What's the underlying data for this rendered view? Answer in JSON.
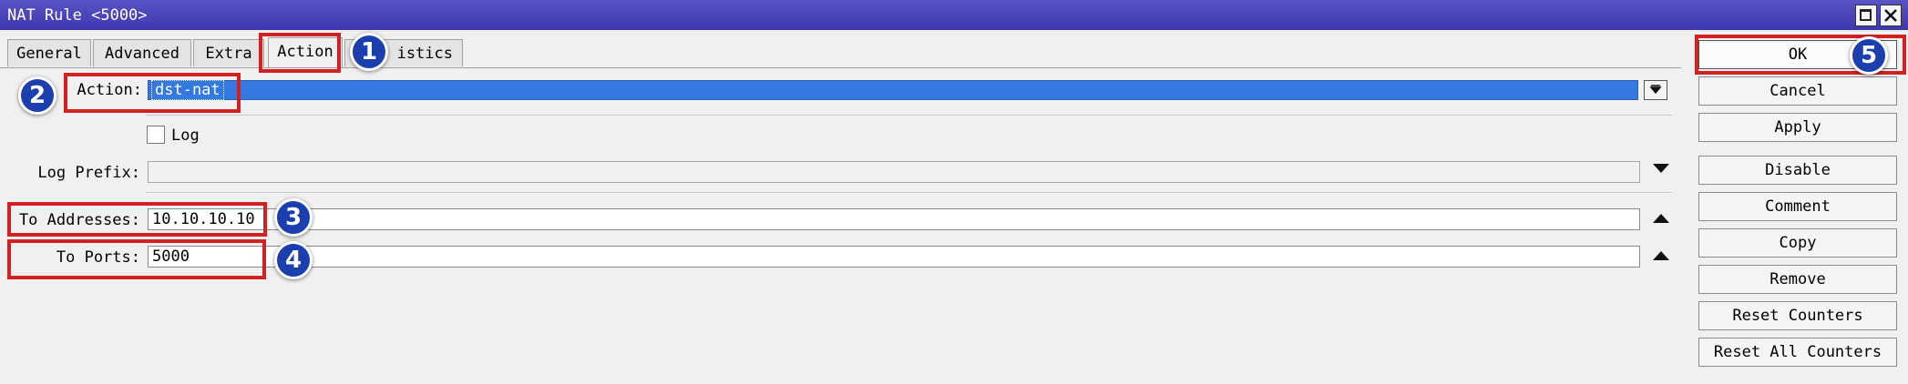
{
  "window": {
    "title": "NAT Rule <5000>"
  },
  "tabs": [
    {
      "label": "General"
    },
    {
      "label": "Advanced"
    },
    {
      "label": "Extra"
    },
    {
      "label": "Action"
    },
    {
      "label": "istics"
    }
  ],
  "form": {
    "action_label": "Action:",
    "action_value": "dst-nat",
    "log_label": "Log",
    "log_checked": false,
    "log_prefix_label": "Log Prefix:",
    "log_prefix_value": "",
    "to_addresses_label": "To Addresses:",
    "to_addresses_value": "10.10.10.10",
    "to_ports_label": "To Ports:",
    "to_ports_value": "5000"
  },
  "buttons": {
    "ok": "OK",
    "cancel": "Cancel",
    "apply": "Apply",
    "disable": "Disable",
    "comment": "Comment",
    "copy": "Copy",
    "remove": "Remove",
    "reset_counters": "Reset Counters",
    "reset_all_counters": "Reset All Counters"
  },
  "badges": [
    "1",
    "2",
    "3",
    "4",
    "5"
  ],
  "colors": {
    "titlebar": "#4a43bc",
    "highlight_box": "#d32020",
    "badge": "#1c3fb0",
    "selected_field": "#3478e0"
  }
}
